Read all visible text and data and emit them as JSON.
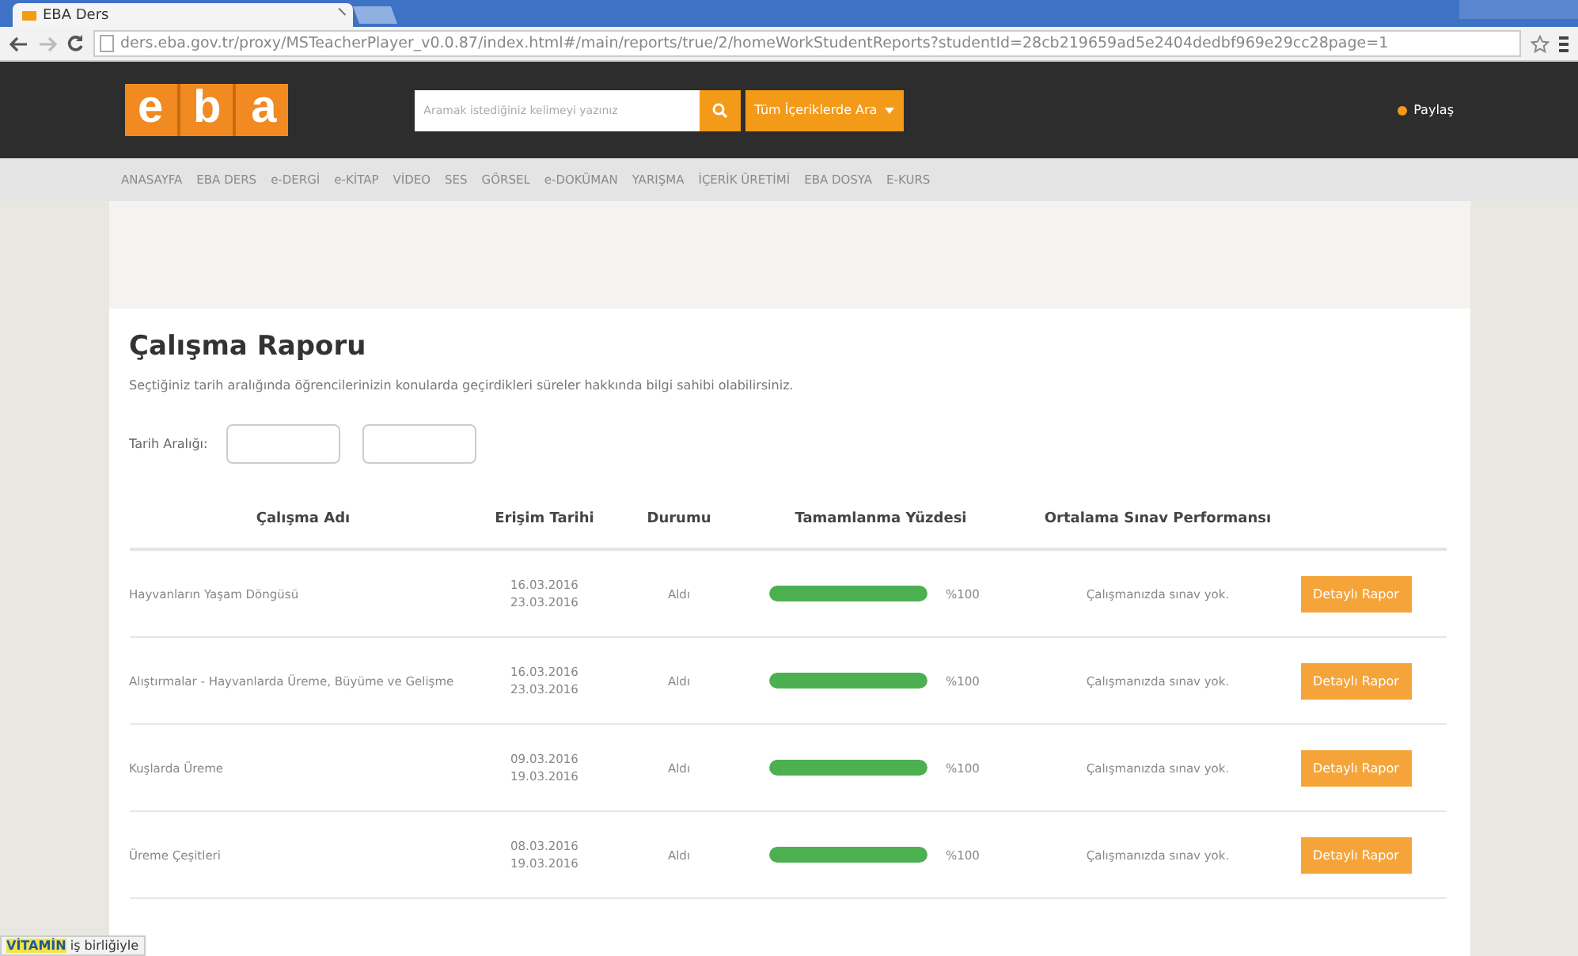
{
  "browser": {
    "tab_title": "EBA Ders",
    "address": "ders.eba.gov.tr/proxy/MSTeacherPlayer_v0.0.87/index.html#/main/reports/true/2/homeWorkStudentReports?studentId=28cb219659ad5e2404dedbf969e29cc28page=1"
  },
  "header": {
    "logo": "eba",
    "search": {
      "placeholder": "Aramak istediğiniz kelimeyi yazınız"
    },
    "search_all_button": "Tüm İçeriklerde Ara",
    "share": "Paylaş"
  },
  "nav": [
    "ANASAYFA",
    "EBA DERS",
    "e-DERGİ",
    "e-KİTAP",
    "VİDEO",
    "SES",
    "GÖRSEL",
    "e-DOKÜMAN",
    "YARIŞMA",
    "İÇERİK ÜRETİMİ",
    "EBA DOSYA",
    "E-KURS"
  ],
  "report": {
    "title": "Çalışma Raporu",
    "description": "Seçtiğiniz tarih aralığında öğrencilerinizin konularda geçirdikleri süreler hakkında bilgi sahibi olabilirsiniz.",
    "date_range_label": "Tarih Aralığı:",
    "columns": [
      "Çalışma Adı",
      "Erişim Tarihi",
      "Durumu",
      "Tamamlanma Yüzdesi",
      "Ortalama Sınav Performansı"
    ],
    "rows": [
      {
        "name": "Hayvanların Yaşam Döngüsü",
        "start": "16.03.2016",
        "end": "23.03.2016",
        "status": "Aldı",
        "level": 1,
        "percent": "%100",
        "exam": "Çalışmanızda sınav yok.",
        "button": "Detaylı Rapor"
      },
      {
        "name": "Alıştırmalar - Hayvanlarda Üreme, Büyüme ve Gelişme",
        "start": "16.03.2016",
        "end": "23.03.2016",
        "status": "Aldı",
        "level": 1,
        "percent": "%100",
        "exam": "Çalışmanızda sınav yok.",
        "button": "Detaylı Rapor"
      },
      {
        "name": "Kuşlarda Üreme",
        "start": "09.03.2016",
        "end": "19.03.2016",
        "status": "Aldı",
        "level": 1,
        "percent": "%100",
        "exam": "Çalışmanızda sınav yok.",
        "button": "Detaylı Rapor"
      },
      {
        "name": "Üreme Çeşitleri",
        "start": "08.03.2016",
        "end": "19.03.2016",
        "status": "Aldı",
        "level": 1,
        "percent": "%100",
        "exam": "Çalışmanızda sınav yok.",
        "button": "Detaylı Rapor"
      }
    ]
  },
  "status_bar": "**VİTAMİN** iş birliğiyle"
}
